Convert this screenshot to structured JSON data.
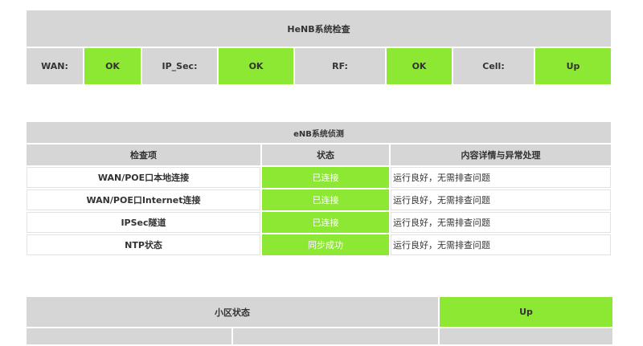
{
  "henb": {
    "title": "HeNB系统检查",
    "statuses": [
      {
        "label": "WAN:",
        "value": "OK"
      },
      {
        "label": "IP_Sec:",
        "value": "OK"
      },
      {
        "label": "RF:",
        "value": "OK"
      },
      {
        "label": "Cell:",
        "value": "Up"
      }
    ]
  },
  "enb": {
    "title": "eNB系统侦测",
    "headers": [
      "检查项",
      "状态",
      "内容详情与异常处理"
    ],
    "rows": [
      {
        "item": "WAN/POE口本地连接",
        "status": "已连接",
        "detail": "运行良好，无需排查问题"
      },
      {
        "item": "WAN/POE口Internet连接",
        "status": "已连接",
        "detail": "运行良好，无需排查问题"
      },
      {
        "item": "IPSec隧道",
        "status": "已连接",
        "detail": "运行良好，无需排查问题"
      },
      {
        "item": "NTP状态",
        "status": "同步成功",
        "detail": "运行良好，无需排查问题"
      }
    ]
  },
  "cell": {
    "title": "小区状态",
    "value": "Up"
  },
  "colors": {
    "ok_green": "#8de834",
    "header_gray": "#d6d6d6"
  }
}
